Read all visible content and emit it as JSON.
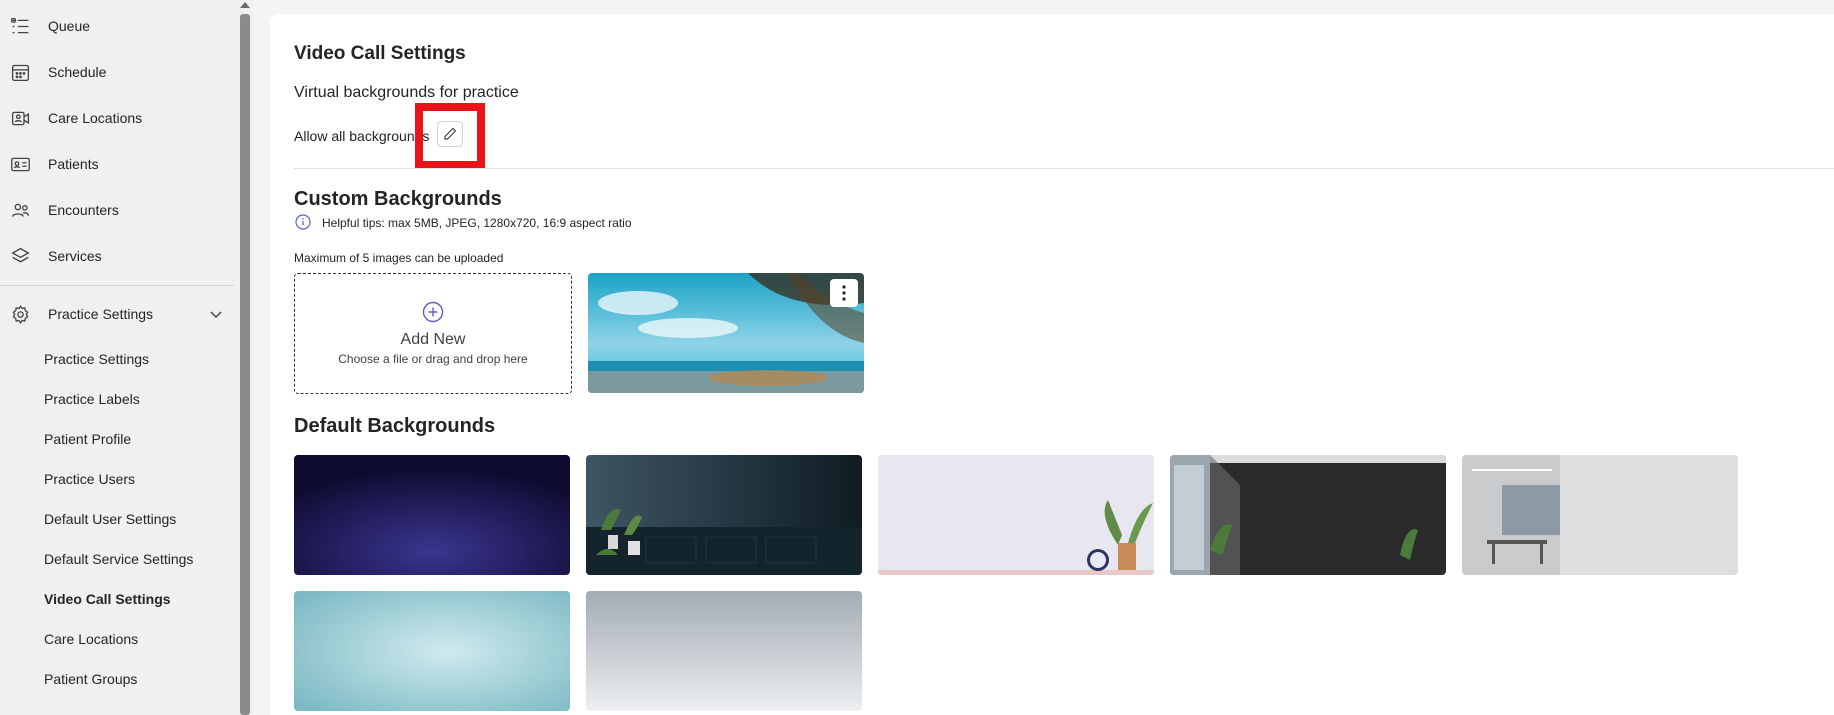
{
  "sidebar": {
    "top_items": [
      {
        "label": "Queue",
        "icon": "queue-list-icon"
      },
      {
        "label": "Schedule",
        "icon": "calendar-icon"
      },
      {
        "label": "Care Locations",
        "icon": "video-person-icon"
      },
      {
        "label": "Patients",
        "icon": "contact-card-icon"
      },
      {
        "label": "Encounters",
        "icon": "people-icon"
      },
      {
        "label": "Services",
        "icon": "layers-icon"
      }
    ],
    "section": {
      "label": "Practice Settings",
      "icon": "gear-icon"
    },
    "sub_items": [
      {
        "label": "Practice Settings"
      },
      {
        "label": "Practice Labels"
      },
      {
        "label": "Patient Profile"
      },
      {
        "label": "Practice Users"
      },
      {
        "label": "Default User Settings"
      },
      {
        "label": "Default Service Settings"
      },
      {
        "label": "Video Call Settings"
      },
      {
        "label": "Care Locations"
      },
      {
        "label": "Patient Groups"
      }
    ],
    "active_sub_item": "Video Call Settings"
  },
  "main": {
    "title": "Video Call Settings",
    "subtitle": "Virtual backgrounds for practice",
    "allow_label": "Allow all backgrounds",
    "custom": {
      "heading": "Custom Backgrounds",
      "tip": "Helpful tips: max 5MB, JPEG, 1280x720, 16:9 aspect ratio",
      "max_note": "Maximum of 5 images can be uploaded",
      "add_title": "Add New",
      "add_sub": "Choose a file or drag and drop here"
    },
    "default": {
      "heading": "Default Backgrounds"
    }
  },
  "colors": {
    "accent": "#5b5fc7",
    "highlight": "#e8141a"
  }
}
